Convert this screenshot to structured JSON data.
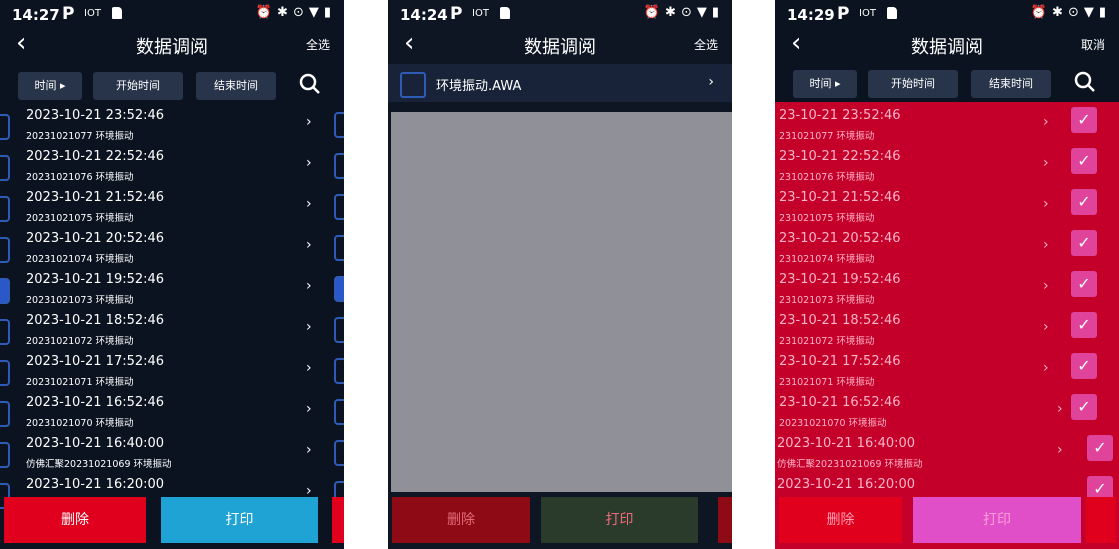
{
  "panels": [
    {
      "status_time": "14:27",
      "title": "数据调阅",
      "action": "全选",
      "filters": {
        "time": "时间 ▸",
        "start": "开始时间",
        "end": "结束时间"
      },
      "rows": [
        {
          "date": "2023-10-21",
          "time": "23:52:46",
          "sub": "20231021077 环境振动"
        },
        {
          "date": "2023-10-21",
          "time": "22:52:46",
          "sub": "20231021076 环境振动"
        },
        {
          "date": "2023-10-21",
          "time": "21:52:46",
          "sub": "20231021075 环境振动"
        },
        {
          "date": "2023-10-21",
          "time": "20:52:46",
          "sub": "20231021074 环境振动"
        },
        {
          "date": "2023-10-21",
          "time": "19:52:46",
          "sub": "20231021073 环境振动"
        },
        {
          "date": "2023-10-21",
          "time": "18:52:46",
          "sub": "20231021072 环境振动"
        },
        {
          "date": "2023-10-21",
          "time": "17:52:46",
          "sub": "20231021071 环境振动"
        },
        {
          "date": "2023-10-21",
          "time": "16:52:46",
          "sub": "20231021070 环境振动"
        },
        {
          "date": "2023-10-21",
          "time": "16:40:00",
          "sub": "仿佛汇聚20231021069 环境振动"
        },
        {
          "date": "2023-10-21",
          "time": "16:20:00",
          "sub": ""
        }
      ],
      "delete": "删除",
      "print": "打印"
    },
    {
      "status_time": "14:24",
      "title": "数据调阅",
      "action": "全选",
      "file": "环境振动.AWA",
      "delete": "删除",
      "print": "打印"
    },
    {
      "status_time": "14:29",
      "title": "数据调阅",
      "action": "取消",
      "filters": {
        "time": "时间 ▸",
        "start": "开始时间",
        "end": "结束时间"
      },
      "rows": [
        {
          "date": "23-10-21",
          "time": "23:52:46",
          "sub": "231021077 环境振动"
        },
        {
          "date": "23-10-21",
          "time": "22:52:46",
          "sub": "231021076 环境振动"
        },
        {
          "date": "23-10-21",
          "time": "21:52:46",
          "sub": "231021075 环境振动"
        },
        {
          "date": "23-10-21",
          "time": "20:52:46",
          "sub": "231021074 环境振动"
        },
        {
          "date": "23-10-21",
          "time": "19:52:46",
          "sub": "231021073 环境振动"
        },
        {
          "date": "23-10-21",
          "time": "18:52:46",
          "sub": "231021072 环境振动"
        },
        {
          "date": "23-10-21",
          "time": "17:52:46",
          "sub": "231021071 环境振动"
        },
        {
          "date": "23-10-21",
          "time": "16:52:46",
          "sub": "20231021070 环境振动"
        },
        {
          "date": "2023-10-21",
          "time": "16:40:00",
          "sub": "仿佛汇聚20231021069 环境振动"
        },
        {
          "date": "2023-10-21",
          "time": "16:20:00",
          "sub": ""
        }
      ],
      "delete": "删除",
      "print": "打印"
    }
  ],
  "status_icons": {
    "p": "P",
    "iot": "IOT",
    "right": "⏰✱⊙▼▮"
  },
  "colors": {
    "delete_red": "#e0001e",
    "print_blue": "#1fa3d4",
    "print_dark_green": "#2a3a2b",
    "print_pink": "#e04fc8",
    "checked_blue": "#2b58c8"
  }
}
